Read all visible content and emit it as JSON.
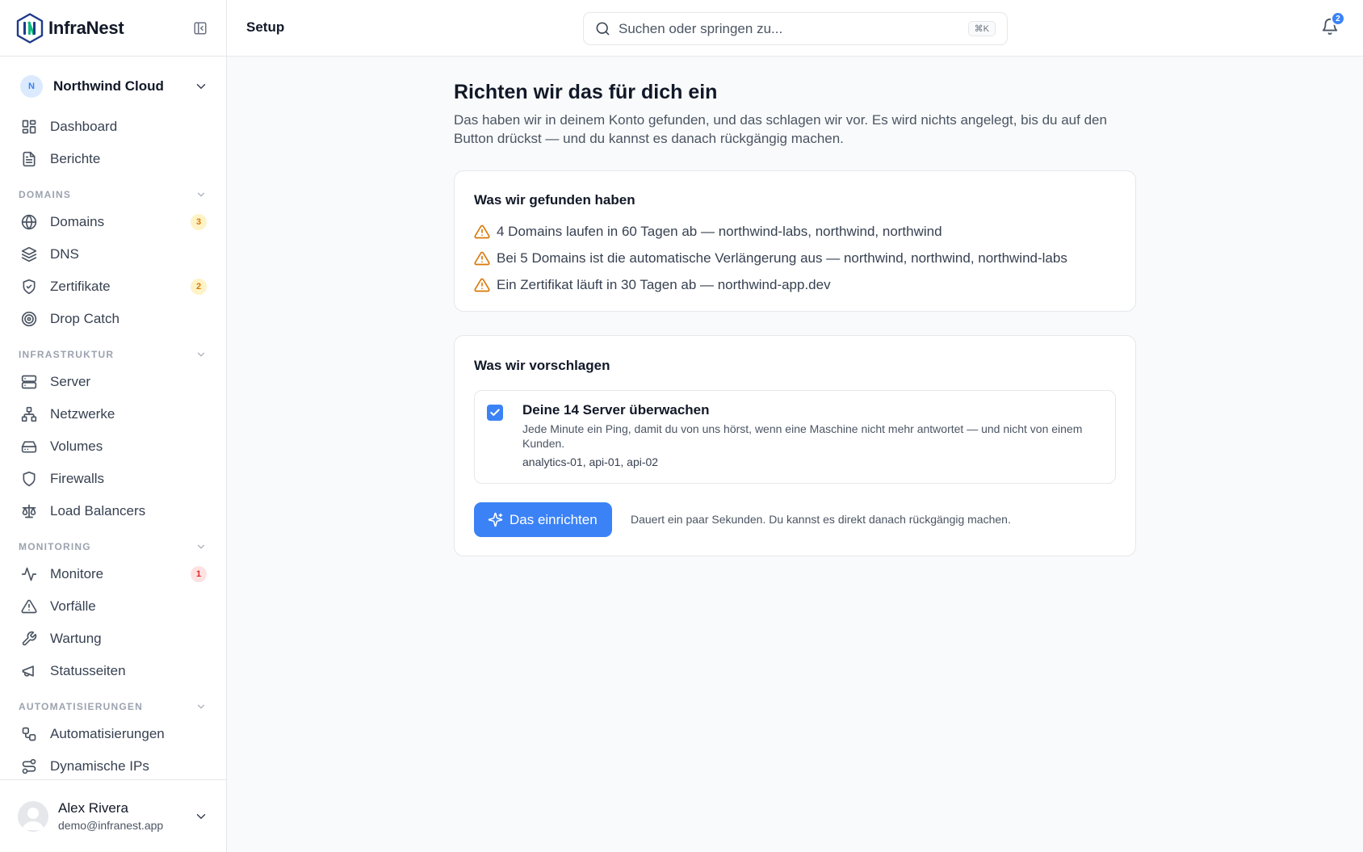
{
  "brand": {
    "name": "InfraNest"
  },
  "org": {
    "initial": "N",
    "name": "Northwind Cloud"
  },
  "nav": {
    "top": [
      {
        "label": "Dashboard",
        "icon": "dashboard-icon"
      },
      {
        "label": "Berichte",
        "icon": "document-icon"
      }
    ],
    "sections": [
      {
        "title": "DOMAINS",
        "items": [
          {
            "label": "Domains",
            "icon": "globe-icon",
            "badge": "3"
          },
          {
            "label": "DNS",
            "icon": "layers-icon"
          },
          {
            "label": "Zertifikate",
            "icon": "shield-check-icon",
            "badge": "2"
          },
          {
            "label": "Drop Catch",
            "icon": "target-icon"
          }
        ]
      },
      {
        "title": "INFRASTRUKTUR",
        "items": [
          {
            "label": "Server",
            "icon": "server-icon"
          },
          {
            "label": "Netzwerke",
            "icon": "network-icon"
          },
          {
            "label": "Volumes",
            "icon": "hard-drive-icon"
          },
          {
            "label": "Firewalls",
            "icon": "shield-icon"
          },
          {
            "label": "Load Balancers",
            "icon": "scale-icon"
          }
        ]
      },
      {
        "title": "MONITORING",
        "items": [
          {
            "label": "Monitore",
            "icon": "activity-icon",
            "badge": "1"
          },
          {
            "label": "Vorfälle",
            "icon": "alert-triangle-icon"
          },
          {
            "label": "Wartung",
            "icon": "wrench-icon"
          },
          {
            "label": "Statusseiten",
            "icon": "megaphone-icon"
          }
        ]
      },
      {
        "title": "AUTOMATISIERUNGEN",
        "items": [
          {
            "label": "Automatisierungen",
            "icon": "workflow-icon"
          },
          {
            "label": "Dynamische IPs",
            "icon": "route-icon"
          }
        ]
      }
    ]
  },
  "user": {
    "name": "Alex Rivera",
    "email": "demo@infranest.app"
  },
  "topbar": {
    "title": "Setup",
    "search_placeholder": "Suchen oder springen zu...",
    "shortcut": "⌘K",
    "notification_count": "2"
  },
  "main": {
    "title": "Richten wir das für dich ein",
    "description": "Das haben wir in deinem Konto gefunden, und das schlagen wir vor. Es wird nichts angelegt, bis du auf den Button drückst — und du kannst es danach rückgängig machen.",
    "found": {
      "title": "Was wir gefunden haben",
      "items": [
        "4 Domains laufen in 60 Tagen ab — northwind-labs, northwind, northwind",
        "Bei 5 Domains ist die automatische Verlängerung aus — northwind, northwind, northwind-labs",
        "Ein Zertifikat läuft in 30 Tagen ab — northwind-app.dev"
      ]
    },
    "suggest": {
      "title": "Was wir vorschlagen",
      "option": {
        "checked": true,
        "title": "Deine 14 Server überwachen",
        "description": "Jede Minute ein Ping, damit du von uns hörst, wenn eine Maschine nicht mehr antwortet — und nicht von einem Kunden.",
        "hosts": "analytics-01, api-01, api-02"
      },
      "button": "Das einrichten",
      "note": "Dauert ein paar Sekunden. Du kannst es direkt danach rückgängig machen."
    }
  },
  "colors": {
    "accent": "#3b82f6",
    "warning": "#d97706",
    "danger": "#dc2626"
  }
}
